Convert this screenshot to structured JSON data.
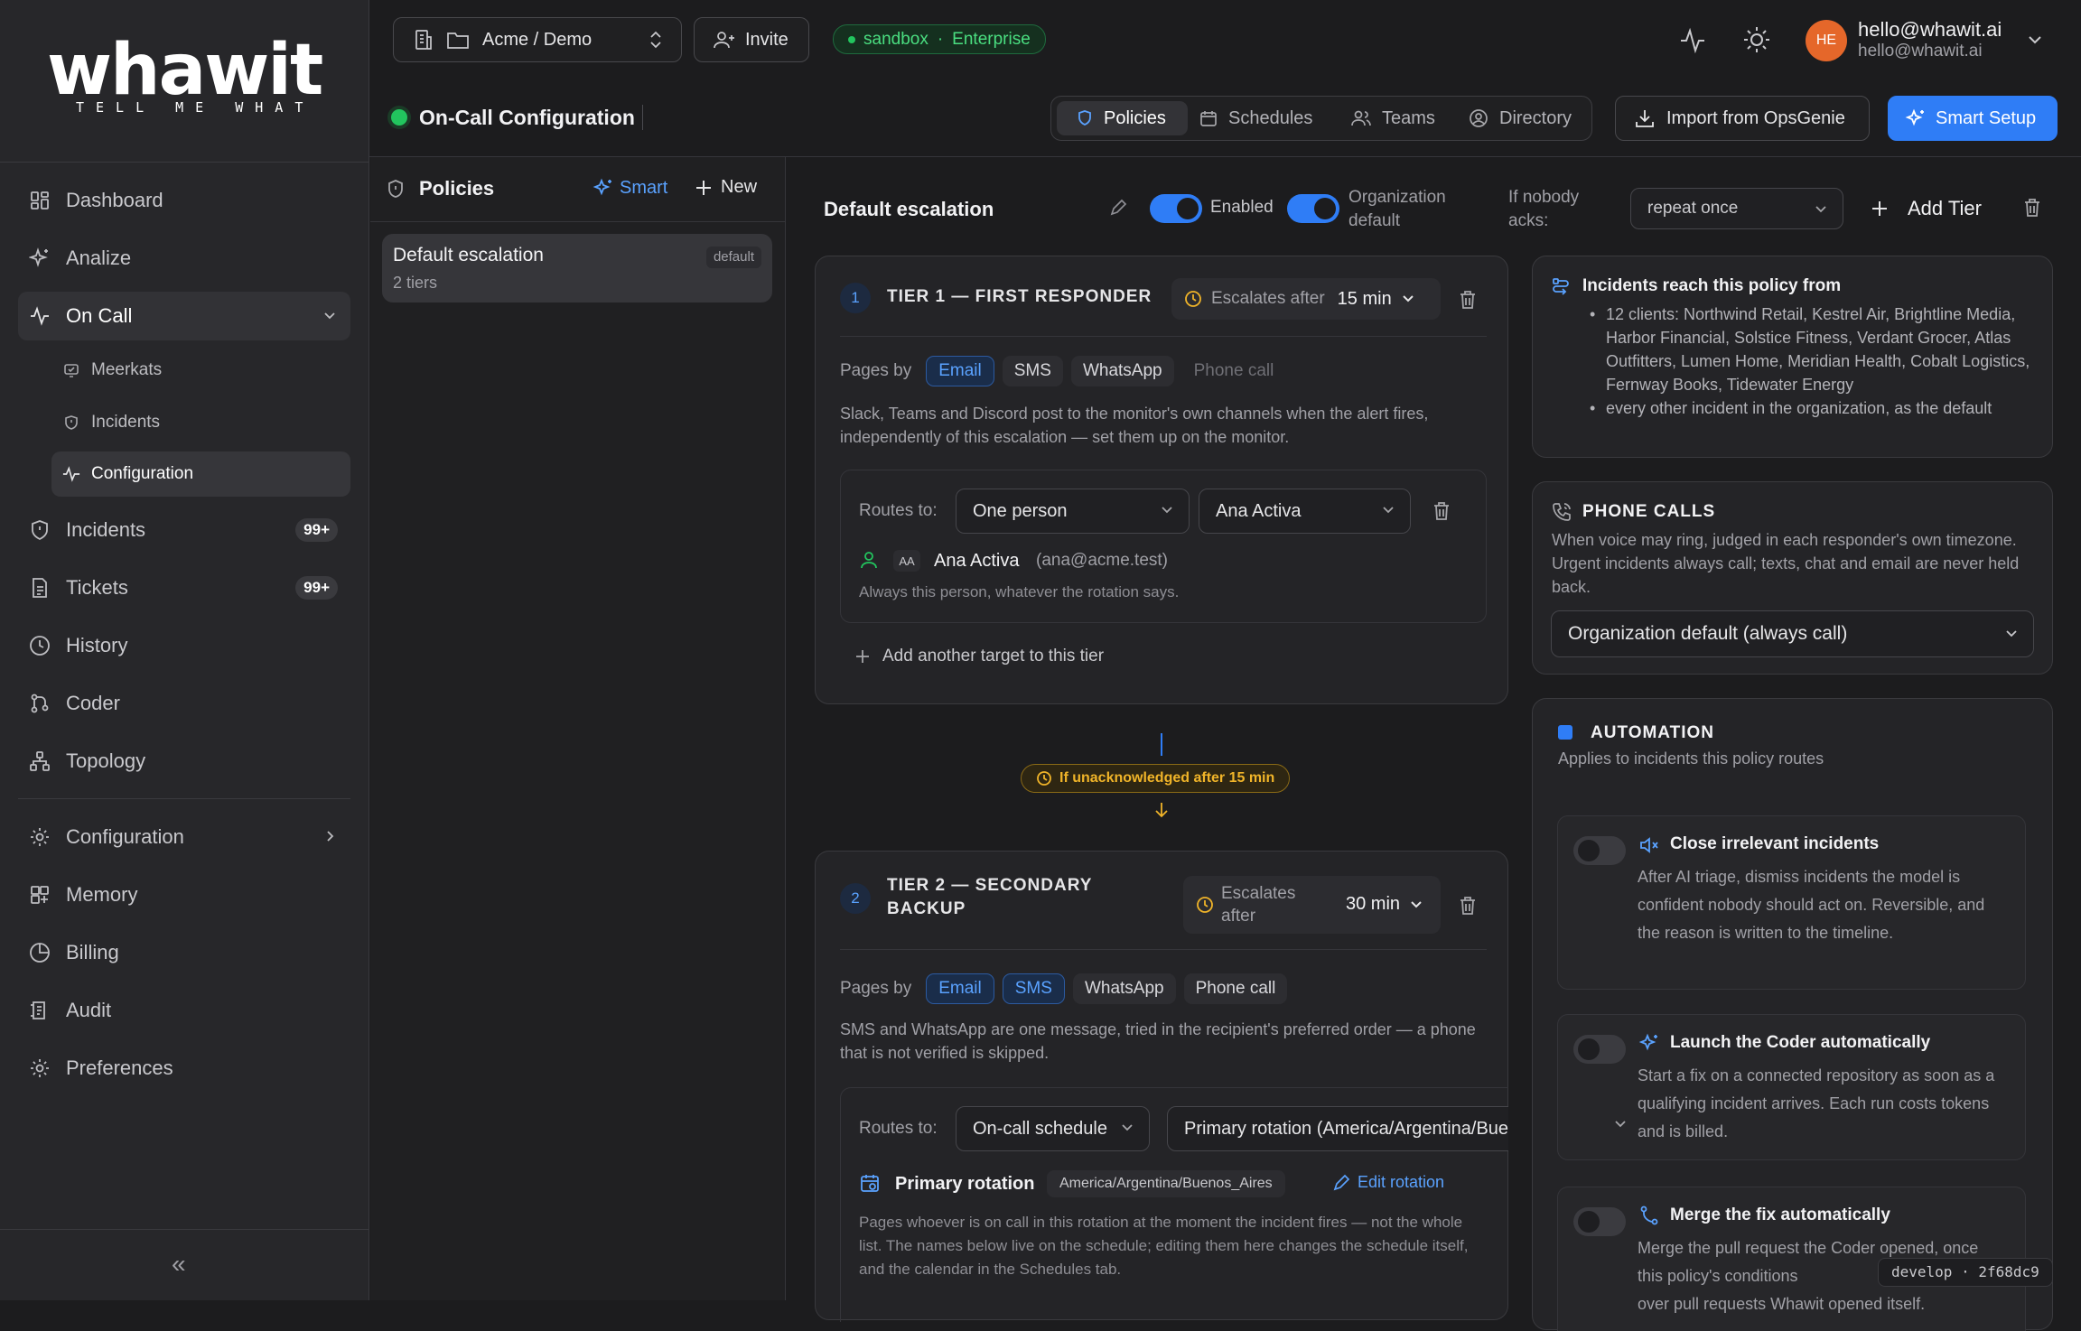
{
  "brand": {
    "wordmark": "whawit",
    "tagline": "TELL ME WHAT"
  },
  "sidebar": {
    "items": [
      {
        "label": "Dashboard",
        "icon": "dashboard-icon"
      },
      {
        "label": "Analize",
        "icon": "sparkles-icon"
      },
      {
        "label": "On Call",
        "icon": "pulse-icon"
      },
      {
        "label": "Incidents",
        "icon": "shield-icon",
        "badge": "99+"
      },
      {
        "label": "Tickets",
        "icon": "document-icon",
        "badge": "99+"
      },
      {
        "label": "History",
        "icon": "clock-icon"
      },
      {
        "label": "Coder",
        "icon": "git-icon"
      },
      {
        "label": "Topology",
        "icon": "topology-icon"
      },
      {
        "label": "Configuration",
        "icon": "gear-icon"
      },
      {
        "label": "Memory",
        "icon": "memory-icon"
      },
      {
        "label": "Billing",
        "icon": "pie-icon"
      },
      {
        "label": "Audit",
        "icon": "audit-icon"
      },
      {
        "label": "Preferences",
        "icon": "gear-icon"
      }
    ],
    "oncall_sub": [
      {
        "label": "Meerkats",
        "icon": "monitor-icon"
      },
      {
        "label": "Incidents",
        "icon": "shield-icon"
      },
      {
        "label": "Configuration",
        "icon": "pulse-icon"
      }
    ],
    "collapse_glyph": "«"
  },
  "topbar": {
    "workspace": "Acme / Demo",
    "invite": "Invite",
    "env": "sandbox",
    "plan": "Enterprise",
    "avatar": "HE",
    "user_name": "hello@whawit.ai",
    "user_email": "hello@whawit.ai"
  },
  "page": {
    "title": "On-Call Configuration",
    "tabs": [
      "Policies",
      "Schedules",
      "Teams",
      "Directory"
    ],
    "import_label": "Import from OpsGenie",
    "smart_setup_label": "Smart Setup"
  },
  "policies": {
    "header": "Policies",
    "smart": "Smart",
    "new": "New",
    "items": [
      {
        "name": "Default escalation",
        "tag": "default",
        "sub": "2 tiers"
      }
    ]
  },
  "policy": {
    "name": "Default escalation",
    "enabled_label": "Enabled",
    "org_default_label": "Organization default",
    "nobody_label": "If nobody acks:",
    "nobody_value": "repeat once",
    "add_tier": "Add Tier",
    "pages_by_label": "Pages by",
    "routes_to_label": "Routes to:",
    "escalates_label": "Escalates after",
    "tier1": {
      "num": "1",
      "title": "TIER 1 — FIRST RESPONDER",
      "escalates": "15 min",
      "channels": [
        {
          "label": "Email",
          "state": "on"
        },
        {
          "label": "SMS",
          "state": "idle"
        },
        {
          "label": "WhatsApp",
          "state": "idle"
        },
        {
          "label": "Phone call",
          "state": "off"
        }
      ],
      "note": "Slack, Teams and Discord post to the monitor's own channels when the alert fires, independently of this escalation — set them up on the monitor.",
      "route_type": "One person",
      "route_target": "Ana Activa",
      "person_initials": "AA",
      "person_name": "Ana Activa",
      "person_email": "(ana@acme.test)",
      "person_hint": "Always this person, whatever the rotation says.",
      "add_target": "Add another target to this tier"
    },
    "connector": "If unacknowledged after 15 min",
    "tier2": {
      "num": "2",
      "title_line1": "TIER 2 — SECONDARY",
      "title_line2": "BACKUP",
      "escalates": "30 min",
      "channels": [
        {
          "label": "Email",
          "state": "on"
        },
        {
          "label": "SMS",
          "state": "on"
        },
        {
          "label": "WhatsApp",
          "state": "idle"
        },
        {
          "label": "Phone call",
          "state": "idle"
        }
      ],
      "note": "SMS and WhatsApp are one message, tried in the recipient's preferred order — a phone that is not verified is skipped.",
      "route_type": "On-call schedule",
      "route_target": "Primary rotation (America/Argentina/Buen",
      "rotation_name": "Primary rotation",
      "rotation_tz": "America/Argentina/Buenos_Aires",
      "edit_rotation": "Edit rotation",
      "rotation_hint": "Pages whoever is on call in this rotation at the moment the incident fires — not the whole list. The names below live on the schedule; editing them here changes the schedule itself, and the calendar in the Schedules tab."
    }
  },
  "right": {
    "reach_title": "Incidents reach this policy from",
    "reach_items": [
      "12 clients: Northwind Retail, Kestrel Air, Brightline Media, Harbor Financial, Solstice Fitness, Verdant Grocer, Atlas Outfitters, Lumen Home, Meridian Health, Cobalt Logistics, Fernway Books, Tidewater Energy",
      "every other incident in the organization, as the default"
    ],
    "phone_title": "PHONE CALLS",
    "phone_desc": "When voice may ring, judged in each responder's own timezone. Urgent incidents always call; texts, chat and email are never held back.",
    "phone_select": "Organization default (always call)",
    "auto_title": "AUTOMATION",
    "auto_desc": "Applies to incidents this policy routes",
    "auto_items": [
      {
        "title": "Close irrelevant incidents",
        "desc": "After AI triage, dismiss incidents the model is confident nobody should act on. Reversible, and the reason is written to the timeline."
      },
      {
        "title": "Launch the Coder automatically",
        "desc": "Start a fix on a connected repository as soon as a qualifying incident arrives. Each run costs tokens and is billed."
      },
      {
        "title": "Merge the fix automatically",
        "desc": "Merge the pull request the Coder opened, once this policy's conditions",
        "desc2": "over pull requests Whawit opened itself."
      }
    ],
    "build": "develop · 2f68dc9"
  },
  "colors": {
    "accent": "#2f7df6",
    "amber": "#f0b429",
    "green": "#22c55e",
    "avatar": "#e5672a"
  }
}
